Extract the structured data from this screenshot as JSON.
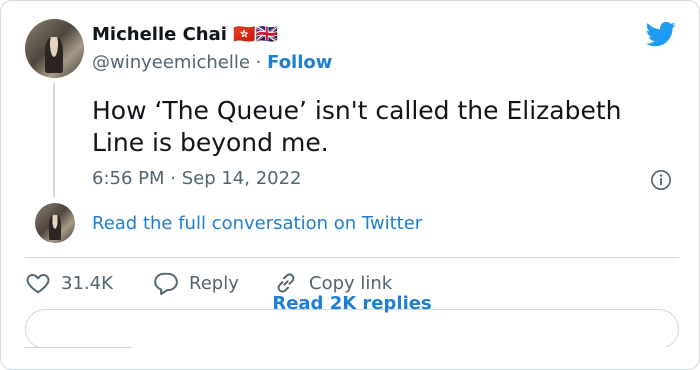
{
  "author": {
    "name": "Michelle Chai 🇭🇰🇬🇧",
    "handle": "@winyeemichelle",
    "separator": "·",
    "follow_label": "Follow"
  },
  "tweet": {
    "text": "How ‘The Queue’ isn't called the Elizabeth Line is beyond me.",
    "timestamp": "6:56 PM · Sep 14, 2022"
  },
  "conversation_link": "Read the full conversation on Twitter",
  "actions": {
    "like_count": "31.4K",
    "reply_label": "Reply",
    "copy_label": "Copy link"
  },
  "replies_button": {
    "label": "Read 2K replies"
  },
  "colors": {
    "accent": "#1d7fd4",
    "twitter_blue": "#1d9bf0",
    "secondary_text": "#536471",
    "border": "#cfd9de"
  },
  "icons": [
    "twitter-bird-icon",
    "info-icon",
    "heart-icon",
    "reply-bubble-icon",
    "link-icon"
  ]
}
